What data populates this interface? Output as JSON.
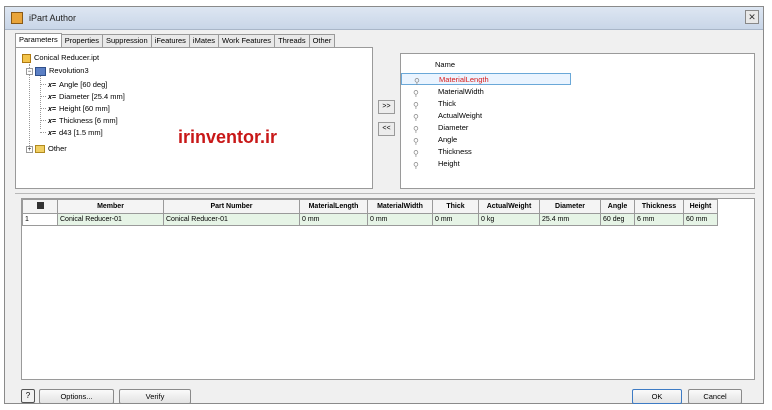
{
  "window": {
    "title": "iPart Author",
    "close_glyph": "✕"
  },
  "tabs": [
    "Parameters",
    "Properties",
    "Suppression",
    "iFeatures",
    "iMates",
    "Work Features",
    "Threads",
    "Other"
  ],
  "tree": {
    "root": "Conical Reducer.ipt",
    "feature": "Revolution3",
    "params": [
      {
        "prefix": "x=",
        "label": "Angle [60 deg]"
      },
      {
        "prefix": "x=",
        "label": "Diameter [25.4 mm]"
      },
      {
        "prefix": "x=",
        "label": "Height [60 mm]"
      },
      {
        "prefix": "x=",
        "label": "Thickness [6 mm]"
      },
      {
        "prefix": "x=",
        "label": "d43 [1.5 mm]"
      }
    ],
    "other": "Other",
    "expand_minus": "−",
    "expand_plus": "+"
  },
  "watermark": "irinventor.ir",
  "move": {
    "add": ">>",
    "remove": "<<"
  },
  "selected_list": {
    "header": "Name",
    "key_icon": "key-icon",
    "items": [
      "MaterialLength",
      "MaterialWidth",
      "Thick",
      "ActualWeight",
      "Diameter",
      "Angle",
      "Thickness",
      "Height"
    ],
    "selected_index": 0,
    "selected_color": "#d81b1b"
  },
  "table": {
    "columns": [
      "",
      "Member",
      "Part Number",
      "MaterialLength",
      "MaterialWidth",
      "Thick",
      "ActualWeight",
      "Diameter",
      "Angle",
      "Thickness",
      "Height"
    ],
    "rows": [
      [
        "1",
        "Conical Reducer-01",
        "Conical Reducer-01",
        "0 mm",
        "0 mm",
        "0 mm",
        "0 kg",
        "25.4 mm",
        "60 deg",
        "6 mm",
        "60 mm"
      ]
    ],
    "row_color": "#e6f4e6"
  },
  "footer": {
    "help": "?",
    "options": "Options...",
    "verify": "Verify",
    "ok": "OK",
    "cancel": "Cancel"
  }
}
